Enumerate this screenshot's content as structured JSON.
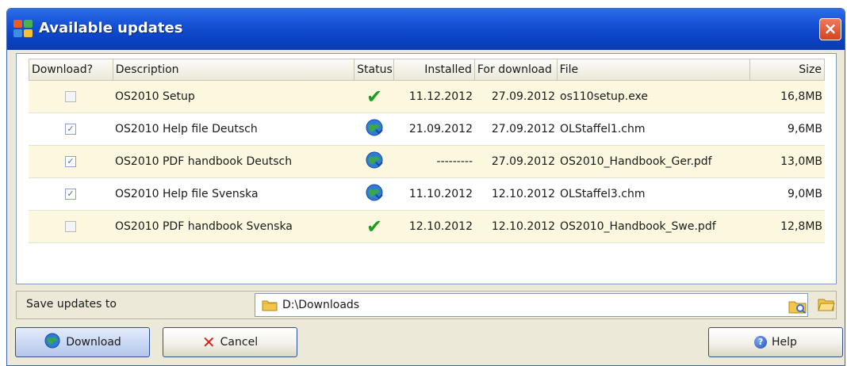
{
  "window": {
    "title": "Available updates",
    "close_label": "×"
  },
  "table": {
    "headers": {
      "download": "Download?",
      "description": "Description",
      "status": "Status",
      "installed": "Installed",
      "for_download": "For download",
      "file": "File",
      "size": "Size"
    },
    "rows": [
      {
        "checked": false,
        "description": "OS2010 Setup",
        "status": "ok-check-icon",
        "installed": "11.12.2012",
        "for_download": "27.09.2012",
        "file": "os110setup.exe",
        "size": "16,8MB"
      },
      {
        "checked": true,
        "description": "OS2010 Help file Deutsch",
        "status": "globe-download-icon",
        "installed": "21.09.2012",
        "for_download": "27.09.2012",
        "file": "OLStaffel1.chm",
        "size": "9,6MB"
      },
      {
        "checked": true,
        "description": "OS2010 PDF handbook Deutsch",
        "status": "globe-download-icon",
        "installed": "---------",
        "for_download": "27.09.2012",
        "file": "OS2010_Handbook_Ger.pdf",
        "size": "13,0MB"
      },
      {
        "checked": true,
        "description": "OS2010 Help file Svenska",
        "status": "globe-download-icon",
        "installed": "11.10.2012",
        "for_download": "12.10.2012",
        "file": "OLStaffel3.chm",
        "size": "9,0MB"
      },
      {
        "checked": false,
        "description": "OS2010 PDF handbook Svenska",
        "status": "ok-check-icon",
        "installed": "12.10.2012",
        "for_download": "12.10.2012",
        "file": "OS2010_Handbook_Swe.pdf",
        "size": "12,8MB"
      }
    ]
  },
  "save": {
    "label": "Save updates to",
    "path": "D:\\Downloads"
  },
  "buttons": {
    "download": "Download",
    "cancel": "Cancel",
    "help": "Help"
  },
  "colors": {
    "titlebar": "#0b43c4",
    "row_alt": "#fbf8df",
    "check_green": "#1e9e1e"
  }
}
